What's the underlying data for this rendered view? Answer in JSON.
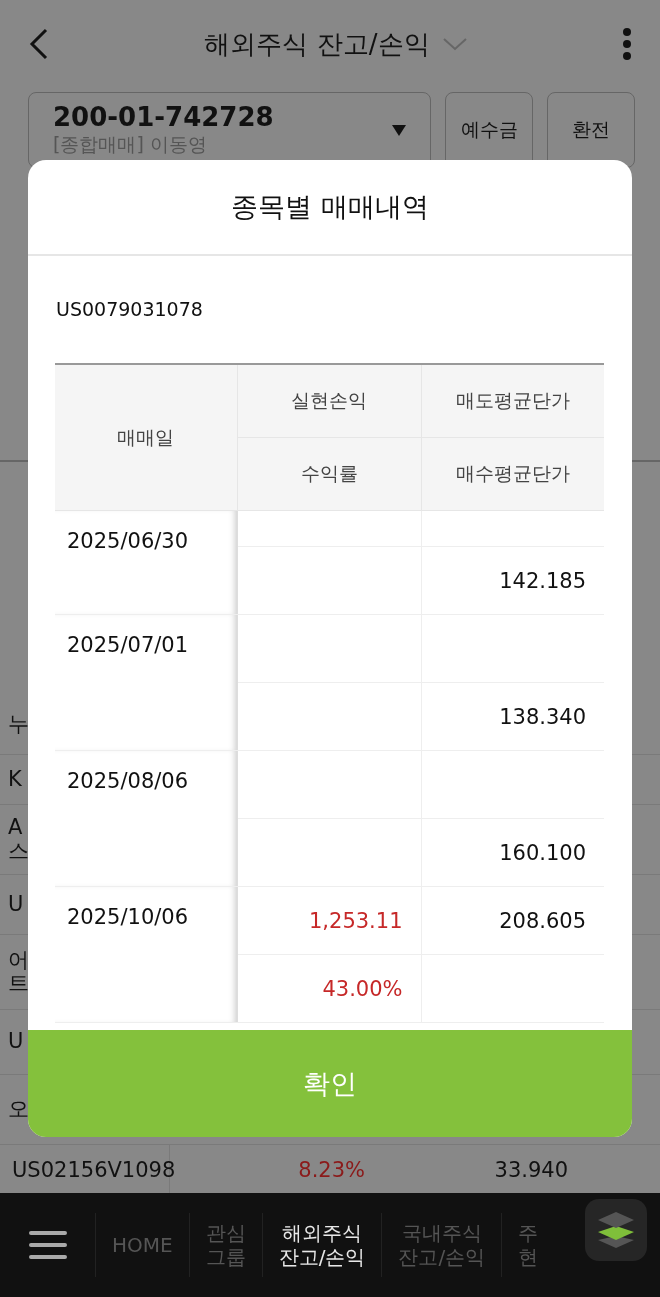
{
  "header": {
    "title": "해외주식 잔고/손익"
  },
  "account": {
    "number": "200-01-742728",
    "owner": "[종합매매] 이동영",
    "buttons": [
      "예수금",
      "환전"
    ]
  },
  "background_rows": [
    {
      "text": "누"
    },
    {
      "text": "K"
    },
    {
      "text": "A\n스"
    },
    {
      "text": "U"
    },
    {
      "text": "어\n트"
    },
    {
      "text": "U"
    },
    {
      "text": "오"
    }
  ],
  "background_last_row": {
    "code": "US02156V1098",
    "rate": "8.23%",
    "price": "33.940"
  },
  "modal": {
    "title": "종목별 매매내역",
    "code": "US0079031078",
    "columns": {
      "date": "매매일",
      "realized_pl": "실현손익",
      "return_rate": "수익률",
      "sell_avg": "매도평균단가",
      "buy_avg": "매수평균단가"
    },
    "rows": [
      {
        "date": "2025/06/30",
        "buy_avg": "142.185"
      },
      {
        "date": "2025/07/01",
        "buy_avg": "138.340"
      },
      {
        "date": "2025/08/06",
        "buy_avg": "160.100"
      },
      {
        "date": "2025/10/06",
        "realized_pl": "1,253.11",
        "sell_avg": "208.605",
        "return_rate": "43.00%"
      }
    ],
    "confirm": "확인"
  },
  "nav": {
    "items": [
      {
        "label": "HOME",
        "selected": false
      },
      {
        "label": "관심\n그룹",
        "selected": false
      },
      {
        "label": "해외주식\n잔고/손익",
        "selected": true
      },
      {
        "label": "국내주식\n잔고/손익",
        "selected": false
      },
      {
        "label": "주\n현",
        "selected": false
      }
    ]
  }
}
